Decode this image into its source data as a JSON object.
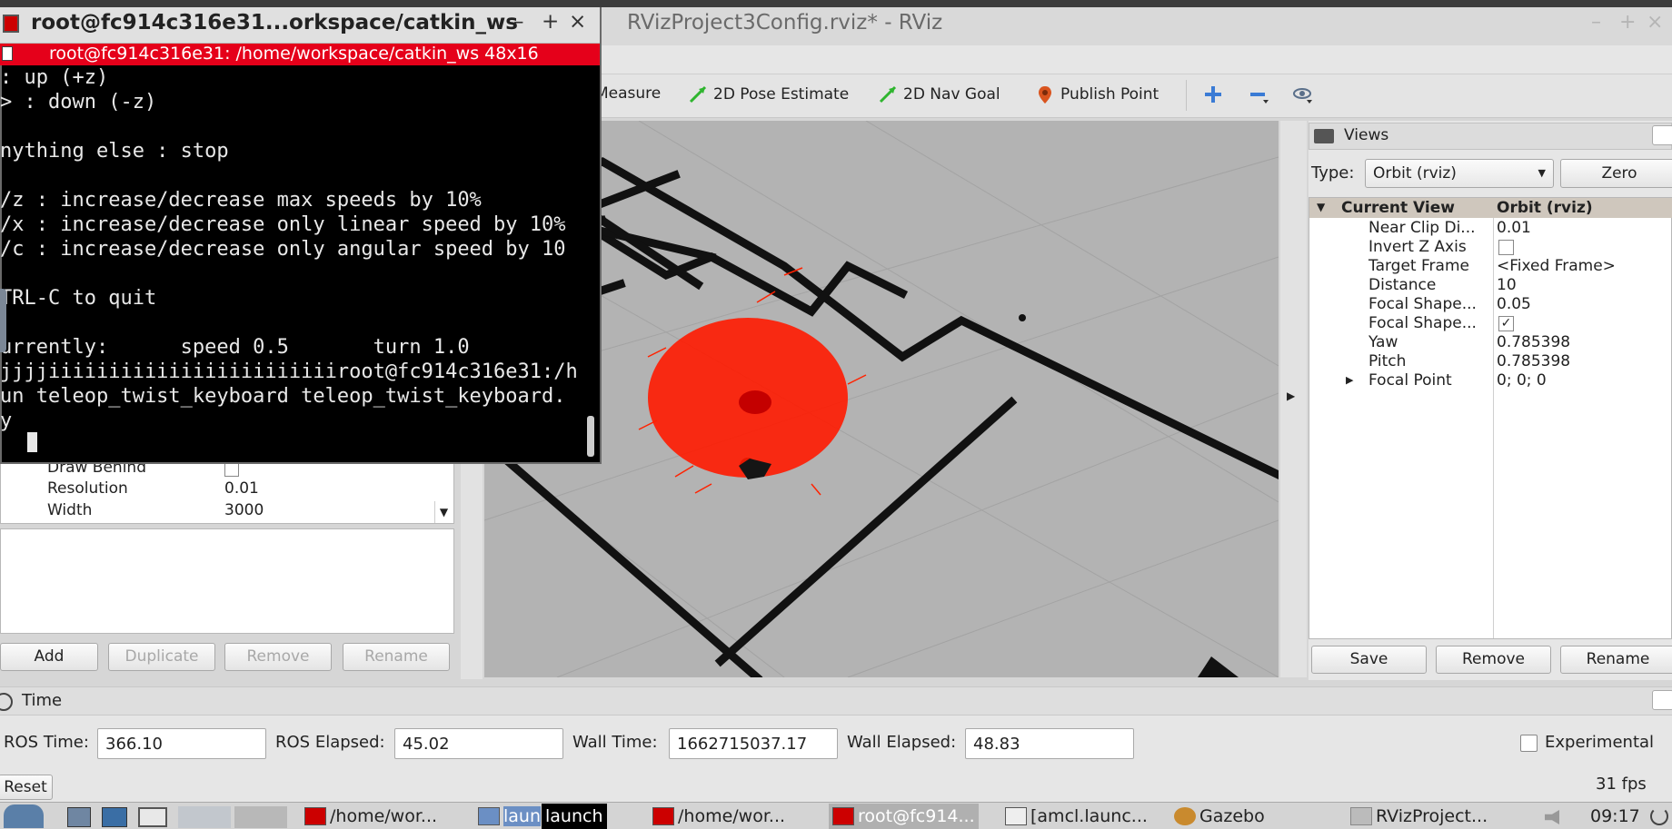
{
  "rviz": {
    "title": "RVizProject3Config.rviz* - RViz",
    "window_controls": [
      "–",
      "+",
      "×"
    ]
  },
  "toolbar": {
    "measure": "Measure",
    "pose_estimate": "2D Pose Estimate",
    "nav_goal": "2D Nav Goal",
    "publish_point": "Publish Point"
  },
  "displays": {
    "rows": [
      {
        "key": "Draw Behind",
        "value": ""
      },
      {
        "key": "Resolution",
        "value": "0.01"
      },
      {
        "key": "Width",
        "value": "3000"
      }
    ],
    "buttons": {
      "add": "Add",
      "duplicate": "Duplicate",
      "remove": "Remove",
      "rename": "Rename"
    }
  },
  "views": {
    "header": "Views",
    "type_label": "Type:",
    "type_value": "Orbit (rviz)",
    "zero": "Zero",
    "current_view": "Current View",
    "current_view_value": "Orbit (rviz)",
    "rows": [
      {
        "key": "Near Clip Di...",
        "value": "0.01"
      },
      {
        "key": "Invert Z Axis",
        "value": ""
      },
      {
        "key": "Target Frame",
        "value": "<Fixed Frame>"
      },
      {
        "key": "Distance",
        "value": "10"
      },
      {
        "key": "Focal Shape...",
        "value": "0.05"
      },
      {
        "key": "Focal Shape...",
        "value": "✓"
      },
      {
        "key": "Yaw",
        "value": "0.785398"
      },
      {
        "key": "Pitch",
        "value": "0.785398"
      },
      {
        "key": "Focal Point",
        "value": "0; 0; 0"
      }
    ],
    "buttons": {
      "save": "Save",
      "remove": "Remove",
      "rename": "Rename"
    }
  },
  "time": {
    "header": "Time",
    "ros_time_label": "ROS Time:",
    "ros_time": "366.10",
    "ros_elapsed_label": "ROS Elapsed:",
    "ros_elapsed": "45.02",
    "wall_time_label": "Wall Time:",
    "wall_time": "1662715037.17",
    "wall_elapsed_label": "Wall Elapsed:",
    "wall_elapsed": "48.83",
    "experimental": "Experimental",
    "reset": "Reset",
    "fps": "31 fps"
  },
  "terminal": {
    "title": "root@fc914c316e31...orkspace/catkin_ws",
    "tab": "root@fc914c316e31: /home/workspace/catkin_ws 48x16",
    "lines": [
      ": up (+z)",
      "> : down (-z)",
      "",
      "nything else : stop",
      "",
      "/z : increase/decrease max speeds by 10%",
      "/x : increase/decrease only linear speed by 10%",
      "/c : increase/decrease only angular speed by 10",
      "",
      "TRL-C to quit",
      "",
      "urrently:      speed 0.5       turn 1.0",
      "jjjjiiiiiiiiiiiiiiiiiiiiiiiiroot@fc914c316e31:/h",
      "un teleop_twist_keyboard teleop_twist_keyboard.",
      "y "
    ]
  },
  "taskbar": {
    "items": [
      "/home/wor...",
      "laun",
      "launch",
      "/home/wor...",
      "root@fc914...",
      "[amcl.launc...",
      "Gazebo",
      "RVizProject..."
    ],
    "clock": "09:17"
  },
  "colors": {
    "terminal_accent": "#e5001a",
    "particles": "#ff1a00",
    "walls": "#111111"
  }
}
